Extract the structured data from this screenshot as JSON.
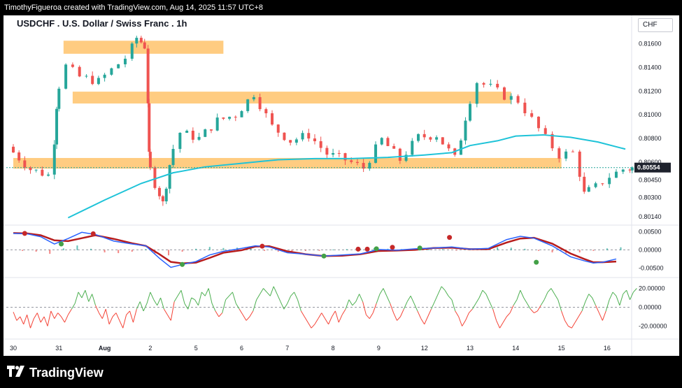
{
  "header": {
    "attribution": "TimothyFigueroa created with TradingView.com, Aug 14, 2025 11:57 UTC+8",
    "title": "USDCHF . U.S. Dollar / Swiss Franc . 1h",
    "currency_button": "CHF"
  },
  "footer": {
    "brand": "TradingView"
  },
  "colors": {
    "bull": "#26a69a",
    "bear": "#ef5350",
    "ema": "#1ec3d8",
    "zone": "#ffc36b",
    "macd_fast": "#2962ff",
    "macd_slow": "#b71c1c",
    "cross_green": "#43a047",
    "cross_red": "#c62828",
    "osc_up": "#4caf50",
    "osc_down": "#f44336"
  },
  "chart_data": [
    {
      "type": "candlestick",
      "title": "USDCHF . U.S. Dollar / Swiss Franc . 1h",
      "x_labels": [
        "30",
        "31",
        "Aug",
        "2",
        "5",
        "6",
        "7",
        "8",
        "9",
        "12",
        "13",
        "14",
        "15",
        "16"
      ],
      "y_ticks": [
        "0.80140",
        "0.80300",
        "0.80450",
        "0.80600",
        "0.80800",
        "0.81000",
        "0.81200",
        "0.81400",
        "0.81600"
      ],
      "ylim": [
        0.8008,
        0.8178
      ],
      "last_price": "0.80554",
      "ema_x_end": 13.9,
      "ema_points": [
        [
          1.2,
          0.8013
        ],
        [
          2.0,
          0.8028
        ],
        [
          2.8,
          0.8042
        ],
        [
          3.5,
          0.8051
        ],
        [
          4.2,
          0.8056
        ],
        [
          5.0,
          0.8059
        ],
        [
          5.8,
          0.8062
        ],
        [
          6.6,
          0.8063
        ],
        [
          7.4,
          0.8063
        ],
        [
          8.2,
          0.8064
        ],
        [
          9.0,
          0.8066
        ],
        [
          9.6,
          0.8068
        ],
        [
          10.0,
          0.8074
        ],
        [
          10.6,
          0.8078
        ],
        [
          11.0,
          0.8082
        ],
        [
          11.6,
          0.8083
        ],
        [
          12.2,
          0.8081
        ],
        [
          12.8,
          0.8077
        ],
        [
          13.4,
          0.8071
        ]
      ],
      "price_path": [
        [
          0,
          0.8073
        ],
        [
          0.5,
          0.8054
        ],
        [
          0.9,
          0.8049
        ],
        [
          1.0,
          0.8108
        ],
        [
          1.3,
          0.8141
        ],
        [
          1.6,
          0.8132
        ],
        [
          2.0,
          0.8128
        ],
        [
          2.3,
          0.8138
        ],
        [
          2.6,
          0.8148
        ],
        [
          2.8,
          0.8165
        ],
        [
          2.95,
          0.8158
        ],
        [
          3.0,
          0.8065
        ],
        [
          3.2,
          0.8042
        ],
        [
          3.35,
          0.8025
        ],
        [
          3.5,
          0.8058
        ],
        [
          3.8,
          0.8085
        ],
        [
          4.2,
          0.808
        ],
        [
          4.6,
          0.8095
        ],
        [
          5.0,
          0.81
        ],
        [
          5.4,
          0.8118
        ],
        [
          5.8,
          0.809
        ],
        [
          6.2,
          0.8078
        ],
        [
          6.6,
          0.8083
        ],
        [
          7.0,
          0.8067
        ],
        [
          7.4,
          0.8062
        ],
        [
          7.8,
          0.8055
        ],
        [
          8.2,
          0.8079
        ],
        [
          8.6,
          0.8062
        ],
        [
          9.0,
          0.8081
        ],
        [
          9.4,
          0.8083
        ],
        [
          9.8,
          0.8063
        ],
        [
          10.0,
          0.8098
        ],
        [
          10.3,
          0.8128
        ],
        [
          10.6,
          0.8123
        ],
        [
          10.9,
          0.8116
        ],
        [
          11.2,
          0.8112
        ],
        [
          11.5,
          0.8096
        ],
        [
          11.8,
          0.808
        ],
        [
          12.1,
          0.8066
        ],
        [
          12.4,
          0.8068
        ],
        [
          12.6,
          0.8033
        ],
        [
          12.9,
          0.8039
        ],
        [
          13.2,
          0.8048
        ],
        [
          13.5,
          0.8054
        ],
        [
          13.6,
          0.8055
        ]
      ],
      "zones": [
        {
          "from_x": 1.1,
          "to_x": 4.6,
          "low": 0.81515,
          "high": 0.81625
        },
        {
          "from_x": 1.3,
          "to_x": 10.9,
          "low": 0.81095,
          "high": 0.81195
        },
        {
          "from_x": 0.0,
          "to_x": 12.0,
          "low": 0.80545,
          "high": 0.80635
        }
      ]
    },
    {
      "type": "line",
      "title": "MACD",
      "y_ticks": [
        "0.00500",
        "0.00000",
        "-0.00500"
      ],
      "ylim": [
        -0.0072,
        0.0062
      ],
      "series": [
        {
          "values": [
            [
              0,
              0.0045
            ],
            [
              0.3,
              0.0044
            ],
            [
              0.6,
              0.0036
            ],
            [
              0.9,
              0.0016
            ],
            [
              1.2,
              0.0031
            ],
            [
              1.5,
              0.0048
            ],
            [
              1.8,
              0.0042
            ],
            [
              2.2,
              0.0024
            ],
            [
              2.6,
              0.0016
            ],
            [
              2.9,
              0.0011
            ],
            [
              3.2,
              -0.0023
            ],
            [
              3.45,
              -0.0048
            ],
            [
              3.7,
              -0.004
            ],
            [
              4.0,
              -0.0032
            ],
            [
              4.3,
              -0.0014
            ],
            [
              4.6,
              -0.0004
            ],
            [
              5.0,
              0.0004
            ],
            [
              5.3,
              0.0011
            ],
            [
              5.6,
              0.0008
            ],
            [
              6.0,
              -0.0008
            ],
            [
              6.4,
              -0.0012
            ],
            [
              6.8,
              -0.0017
            ],
            [
              7.2,
              -0.0014
            ],
            [
              7.6,
              -0.0011
            ],
            [
              8.0,
              0.0001
            ],
            [
              8.4,
              -0.0001
            ],
            [
              8.8,
              0.0003
            ],
            [
              9.2,
              0.0005
            ],
            [
              9.6,
              0.0008
            ],
            [
              10.0,
              0.0002
            ],
            [
              10.4,
              0.0004
            ],
            [
              10.8,
              0.0028
            ],
            [
              11.1,
              0.0037
            ],
            [
              11.4,
              0.0032
            ],
            [
              11.8,
              0.0011
            ],
            [
              12.2,
              -0.0019
            ],
            [
              12.5,
              -0.003
            ],
            [
              12.7,
              -0.0036
            ],
            [
              12.9,
              -0.0034
            ],
            [
              13.2,
              -0.0025
            ]
          ]
        },
        {
          "values": [
            [
              0,
              0.0046
            ],
            [
              0.3,
              0.0045
            ],
            [
              0.6,
              0.004
            ],
            [
              0.9,
              0.0026
            ],
            [
              1.2,
              0.0024
            ],
            [
              1.5,
              0.0032
            ],
            [
              1.8,
              0.004
            ],
            [
              2.2,
              0.003
            ],
            [
              2.6,
              0.0018
            ],
            [
              2.9,
              0.0011
            ],
            [
              3.2,
              -0.0012
            ],
            [
              3.45,
              -0.0033
            ],
            [
              3.7,
              -0.0037
            ],
            [
              4.0,
              -0.0035
            ],
            [
              4.3,
              -0.0022
            ],
            [
              4.6,
              -0.0008
            ],
            [
              5.0,
              -0.0001
            ],
            [
              5.3,
              0.0009
            ],
            [
              5.6,
              0.001
            ],
            [
              6.0,
              -0.0004
            ],
            [
              6.4,
              -0.0012
            ],
            [
              6.8,
              -0.0017
            ],
            [
              7.2,
              -0.0016
            ],
            [
              7.6,
              -0.0012
            ],
            [
              8.0,
              -0.0003
            ],
            [
              8.4,
              -0.0002
            ],
            [
              8.8,
              0.0
            ],
            [
              9.2,
              0.0005
            ],
            [
              9.6,
              0.0006
            ],
            [
              10.0,
              0.0002
            ],
            [
              10.4,
              0.0002
            ],
            [
              10.8,
              0.002
            ],
            [
              11.1,
              0.0031
            ],
            [
              11.4,
              0.0033
            ],
            [
              11.8,
              0.0017
            ],
            [
              12.2,
              -0.001
            ],
            [
              12.5,
              -0.0025
            ],
            [
              12.7,
              -0.0034
            ],
            [
              12.9,
              -0.0034
            ],
            [
              13.2,
              -0.0032
            ]
          ]
        }
      ],
      "histogram_points": [
        [
          0.2,
          -0.0002
        ],
        [
          0.5,
          -0.0004
        ],
        [
          0.8,
          -0.001
        ],
        [
          1.1,
          0.0004
        ],
        [
          1.4,
          0.0012
        ],
        [
          1.7,
          0.0003
        ],
        [
          2.0,
          -0.0006
        ],
        [
          2.3,
          -0.0008
        ],
        [
          2.6,
          -0.0004
        ],
        [
          2.9,
          0.0002
        ],
        [
          3.1,
          -0.0009
        ],
        [
          3.4,
          -0.0014
        ],
        [
          3.7,
          -0.0004
        ],
        [
          4.0,
          0.0003
        ],
        [
          4.3,
          0.0008
        ],
        [
          4.6,
          0.0005
        ],
        [
          4.9,
          0.0006
        ],
        [
          5.2,
          0.0004
        ],
        [
          5.5,
          -0.0002
        ],
        [
          5.8,
          -0.0004
        ],
        [
          6.1,
          -0.0003
        ],
        [
          6.4,
          -0.0002
        ],
        [
          6.7,
          -0.0002
        ],
        [
          7.0,
          0.0001
        ],
        [
          7.3,
          0.0002
        ],
        [
          7.6,
          0.0003
        ],
        [
          7.9,
          0.0005
        ],
        [
          8.2,
          0.0003
        ],
        [
          8.5,
          0.0002
        ],
        [
          8.8,
          0.0003
        ],
        [
          9.1,
          0.0001
        ],
        [
          9.4,
          0.0002
        ],
        [
          9.7,
          -0.0001
        ],
        [
          10.0,
          0.0002
        ],
        [
          10.3,
          0.0004
        ],
        [
          10.6,
          0.0007
        ],
        [
          10.9,
          0.0006
        ],
        [
          11.2,
          0.0003
        ],
        [
          11.5,
          -0.0002
        ],
        [
          11.8,
          -0.0006
        ],
        [
          12.1,
          -0.0009
        ],
        [
          12.4,
          -0.0006
        ],
        [
          12.7,
          -0.0002
        ],
        [
          13.0,
          0.0004
        ],
        [
          13.3,
          0.0007
        ]
      ],
      "cross_markers": [
        {
          "x": 0.25,
          "y": 0.0045,
          "signal": "bear"
        },
        {
          "x": 1.05,
          "y": 0.0016,
          "signal": "bull"
        },
        {
          "x": 1.75,
          "y": 0.0044,
          "signal": "bear"
        },
        {
          "x": 3.7,
          "y": -0.004,
          "signal": "bull"
        },
        {
          "x": 5.45,
          "y": 0.001,
          "signal": "bear"
        },
        {
          "x": 6.8,
          "y": -0.0017,
          "signal": "bull"
        },
        {
          "x": 7.55,
          "y": 0.0002,
          "signal": "bear"
        },
        {
          "x": 7.75,
          "y": 0.0002,
          "signal": "bear"
        },
        {
          "x": 7.95,
          "y": 0.0003,
          "signal": "bull"
        },
        {
          "x": 8.3,
          "y": 0.0007,
          "signal": "bear"
        },
        {
          "x": 8.9,
          "y": 0.0005,
          "signal": "bull"
        },
        {
          "x": 9.55,
          "y": 0.0034,
          "signal": "bear"
        },
        {
          "x": 11.45,
          "y": -0.0034,
          "signal": "bull"
        }
      ]
    },
    {
      "type": "line",
      "title": "Oscillator",
      "y_ticks": [
        "20.00000",
        "0.00000",
        "-20.00000"
      ],
      "ylim": [
        -30,
        30
      ],
      "values": [
        -5,
        -14,
        -10,
        -18,
        -8,
        -22,
        -12,
        -6,
        -16,
        -10,
        -20,
        -4,
        -12,
        -6,
        -10,
        -16,
        -8,
        -2,
        4,
        16,
        10,
        18,
        6,
        14,
        2,
        -6,
        -12,
        -2,
        -18,
        -10,
        -6,
        -14,
        -22,
        -8,
        -4,
        -16,
        -2,
        6,
        -4,
        4,
        16,
        8,
        2,
        10,
        -2,
        -8,
        -14,
        6,
        12,
        18,
        4,
        -2,
        10,
        8,
        2,
        16,
        12,
        20,
        4,
        -4,
        -10,
        -6,
        8,
        12,
        16,
        4,
        -2,
        -8,
        -14,
        -10,
        -4,
        8,
        14,
        20,
        16,
        12,
        22,
        14,
        6,
        -2,
        4,
        12,
        16,
        8,
        -4,
        -10,
        -16,
        -22,
        -18,
        -12,
        -6,
        -12,
        -18,
        -10,
        -4,
        -16,
        -8,
        -2,
        8,
        2,
        6,
        14,
        6,
        -8,
        -12,
        -6,
        4,
        14,
        20,
        12,
        4,
        -6,
        -14,
        -10,
        -2,
        6,
        12,
        4,
        -4,
        -12,
        -18,
        -10,
        -2,
        6,
        14,
        22,
        18,
        12,
        8,
        -4,
        -10,
        -20,
        -14,
        -6,
        -2,
        4,
        10,
        18,
        14,
        6,
        -2,
        -14,
        -22,
        -16,
        -10,
        -6,
        2,
        8,
        18,
        10,
        4,
        -2,
        -6,
        -4,
        2,
        8,
        16,
        20,
        14,
        8,
        -4,
        -14,
        -20,
        -22,
        -16,
        -10,
        -4,
        6,
        14,
        10,
        2,
        -6,
        -14,
        -4,
        8,
        16,
        12,
        2,
        14,
        18,
        8,
        16,
        20
      ]
    }
  ],
  "time_axis_positions_note": "x unit = trading-day index; labels at integer positions"
}
